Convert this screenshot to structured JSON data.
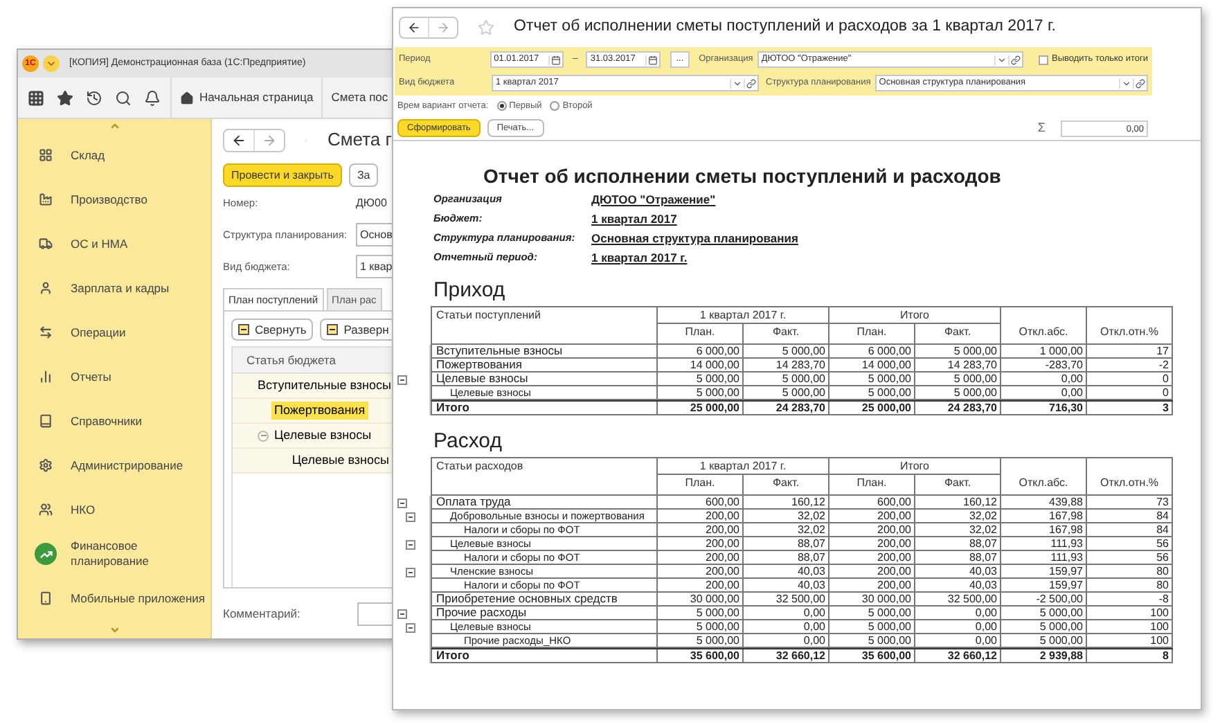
{
  "background_window": {
    "logo": "1С",
    "title": "[КОПИЯ] Демонстрационная база (1С:Предприятие)",
    "home_tab": "Начальная страница",
    "open_tab": "Смета пос",
    "sidebar": {
      "items": [
        {
          "label": "Склад",
          "selected": false
        },
        {
          "label": "Производство",
          "selected": false
        },
        {
          "label": "ОС и НМА",
          "selected": false
        },
        {
          "label": "Зарплата и кадры",
          "selected": false
        },
        {
          "label": "Операции",
          "selected": false
        },
        {
          "label": "Отчеты",
          "selected": false
        },
        {
          "label": "Справочники",
          "selected": false
        },
        {
          "label": "Администрирование",
          "selected": false
        },
        {
          "label": "НКО",
          "selected": false
        },
        {
          "label": "Финансовое планирование",
          "selected": true
        },
        {
          "label": "Мобильные приложения",
          "selected": false
        }
      ]
    },
    "form": {
      "title": "Смета г",
      "buttons": [
        {
          "label": "Провести и закрыть",
          "kind": "primary"
        },
        {
          "label": "За",
          "kind": "default"
        }
      ],
      "fields": [
        {
          "label": "Номер:",
          "value": "ДЮ00"
        },
        {
          "label": "Структура планирования:",
          "value": "Основ"
        },
        {
          "label": "Вид бюджета:",
          "value": "1 квар"
        }
      ],
      "tabs": [
        {
          "label": "План поступлений",
          "selected": true
        },
        {
          "label": "План рас",
          "selected": false
        }
      ],
      "list_buttons": [
        "Свернуть",
        "Разверн"
      ],
      "list_header": "Статья бюджета",
      "rows": [
        {
          "label": "Вступительные взносы",
          "selected": false
        },
        {
          "label": "Пожертвования",
          "selected": true
        },
        {
          "label": "Целевые взносы",
          "selected": false,
          "expanded": true,
          "children": [
            {
              "label": "Целевые взносы",
              "selected": false
            }
          ]
        }
      ],
      "comment_label": "Комментарий:"
    }
  },
  "report_window": {
    "title": "Отчет об исполнении сметы поступлений и расходов за 1 квартал 2017 г.",
    "filters": {
      "period_label": "Период",
      "date_from": "01.01.2017",
      "dash": "–",
      "date_to": "31.03.2017",
      "more_button": "...",
      "org_label": "Организация",
      "org_value": "ДЮТОО \"Отражение\"",
      "totals_only": {
        "label": "Выводить только итоги",
        "checked": false
      },
      "budget_label": "Вид бюджета",
      "budget_value": "1 квартал 2017",
      "structure_label": "Структура планирования",
      "structure_value": "Основная структура планирования"
    },
    "variant": {
      "label": "Врем вариант отчета:",
      "options": [
        {
          "label": "Первый",
          "selected": true
        },
        {
          "label": "Второй",
          "selected": false
        }
      ]
    },
    "actions": [
      {
        "label": "Сформировать",
        "kind": "primary"
      },
      {
        "label": "Печать...",
        "kind": "default"
      }
    ],
    "sum_symbol": "Σ",
    "sum_value": "0,00",
    "report": {
      "heading": "Отчет об исполнении сметы поступлений и расходов",
      "fields": [
        {
          "label": "Организация",
          "value": "ДЮТОО \"Отражение\""
        },
        {
          "label": "Бюджет:",
          "value": "1 квартал 2017"
        },
        {
          "label": "Структура планирования:",
          "value": "Основная структура планирования"
        },
        {
          "label": "Отчетный период:",
          "value": "1 квартал 2017 г."
        }
      ],
      "sections": [
        {
          "title": "Приход",
          "header": {
            "row_label": "Статьи поступлений",
            "groups": [
              "1 квартал 2017 г.",
              "Итого"
            ],
            "columns": [
              "План.",
              "Факт.",
              "План.",
              "Факт.",
              "Откл.абс.",
              "Откл.отн.%"
            ]
          },
          "rows": [
            {
              "label": "Вступительные взносы",
              "values": [
                "6 000,00",
                "5 000,00",
                "6 000,00",
                "5 000,00",
                "1 000,00",
                "17"
              ]
            },
            {
              "label": "Пожертвования",
              "values": [
                "14 000,00",
                "14 283,70",
                "14 000,00",
                "14 283,70",
                "-283,70",
                "-2"
              ]
            },
            {
              "label": "Целевые взносы",
              "values": [
                "5 000,00",
                "5 000,00",
                "5 000,00",
                "5 000,00",
                "0,00",
                "0"
              ],
              "expanded": true,
              "children": [
                {
                  "label": "Целевые взносы",
                  "values": [
                    "5 000,00",
                    "5 000,00",
                    "5 000,00",
                    "5 000,00",
                    "0,00",
                    "0"
                  ]
                }
              ]
            }
          ],
          "total": {
            "label": "Итого",
            "values": [
              "25 000,00",
              "24 283,70",
              "25 000,00",
              "24 283,70",
              "716,30",
              "3"
            ]
          }
        },
        {
          "title": "Расход",
          "header": {
            "row_label": "Статьи расходов",
            "groups": [
              "1 квартал 2017 г.",
              "Итого"
            ],
            "columns": [
              "План.",
              "Факт.",
              "План.",
              "Факт.",
              "Откл.абс.",
              "Откл.отн.%"
            ]
          },
          "rows": [
            {
              "label": "Оплата труда",
              "values": [
                "600,00",
                "160,12",
                "600,00",
                "160,12",
                "439,88",
                "73"
              ],
              "expanded": true,
              "children": [
                {
                  "label": "Добровольные взносы и пожертвования",
                  "values": [
                    "200,00",
                    "32,02",
                    "200,00",
                    "32,02",
                    "167,98",
                    "84"
                  ],
                  "expanded": true,
                  "children": [
                    {
                      "label": "Налоги и сборы по ФОТ",
                      "values": [
                        "200,00",
                        "32,02",
                        "200,00",
                        "32,02",
                        "167,98",
                        "84"
                      ]
                    }
                  ]
                },
                {
                  "label": "Целевые взносы",
                  "values": [
                    "200,00",
                    "88,07",
                    "200,00",
                    "88,07",
                    "111,93",
                    "56"
                  ],
                  "expanded": true,
                  "children": [
                    {
                      "label": "Налоги и сборы по ФОТ",
                      "values": [
                        "200,00",
                        "88,07",
                        "200,00",
                        "88,07",
                        "111,93",
                        "56"
                      ]
                    }
                  ]
                },
                {
                  "label": "Членские взносы",
                  "values": [
                    "200,00",
                    "40,03",
                    "200,00",
                    "40,03",
                    "159,97",
                    "80"
                  ],
                  "expanded": true,
                  "children": [
                    {
                      "label": "Налоги и сборы по ФОТ",
                      "values": [
                        "200,00",
                        "40,03",
                        "200,00",
                        "40,03",
                        "159,97",
                        "80"
                      ]
                    }
                  ]
                }
              ]
            },
            {
              "label": "Приобретение основных средств",
              "values": [
                "30 000,00",
                "32 500,00",
                "30 000,00",
                "32 500,00",
                "-2 500,00",
                "-8"
              ]
            },
            {
              "label": "Прочие расходы",
              "values": [
                "5 000,00",
                "0,00",
                "5 000,00",
                "0,00",
                "5 000,00",
                "100"
              ],
              "expanded": true,
              "children": [
                {
                  "label": "Целевые взносы",
                  "values": [
                    "5 000,00",
                    "0,00",
                    "5 000,00",
                    "0,00",
                    "5 000,00",
                    "100"
                  ],
                  "expanded": true,
                  "children": [
                    {
                      "label": "Прочие расходы_НКО",
                      "values": [
                        "5 000,00",
                        "0,00",
                        "5 000,00",
                        "0,00",
                        "5 000,00",
                        "100"
                      ]
                    }
                  ]
                }
              ]
            }
          ],
          "total": {
            "label": "Итого",
            "values": [
              "35 600,00",
              "32 660,12",
              "35 600,00",
              "32 660,12",
              "2 939,88",
              "8"
            ]
          }
        }
      ]
    }
  }
}
